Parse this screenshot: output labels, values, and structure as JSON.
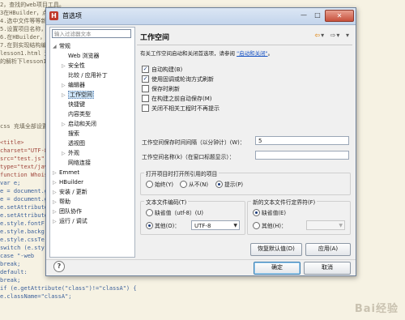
{
  "background_code": {
    "lines": [
      "2，查找的web项目工具。",
      "3在HBuilder，点击\"新建",
      "4.选中文件等等新建。",
      "5.设置项目名称，建立目录，",
      "6.在HBuilder，新建项目，复制",
      "7.在到实现结构编辑位置，的编辑文件",
      "lesson1.html 运行文件的",
      "的解析下lesson1基本结构",
      "",
      "",
      "",
      "",
      "",
      "",
      "",
      "css 充填全部设置",
      "",
      "<title>",
      "charset=\"UTF-8\"",
      "src=\"test.js\"",
      "type=\"text/java",
      "function Whoist (",
      "var e;",
      "e = document.get",
      "e = document.get",
      "e.setAttribute",
      "e.setAttribute",
      "e.style.fontF",
      "e.style.backg",
      "e.style.cssTe",
      "switch (e.sty",
      "    case \"-web",
      "        break;",
      "    default:",
      "        break;",
      "if (e.getAttribute(\"class\")!=\"classA\") {",
      "    e.className=\"classA\";"
    ],
    "watermark": "Bai经验"
  },
  "dialog": {
    "title": "首选项",
    "app_icon_letter": "H",
    "window_controls": {
      "minimize": "—",
      "maximize": "□",
      "close": "✕"
    }
  },
  "left_panel": {
    "filter_placeholder": "输入过滤器文本",
    "tree": [
      {
        "label": "常规",
        "arrow": "◢",
        "level": 0
      },
      {
        "label": "Web 浏览器",
        "arrow": "",
        "level": 1
      },
      {
        "label": "安全性",
        "arrow": "▷",
        "level": 1
      },
      {
        "label": "比较 / 应用补丁",
        "arrow": "",
        "level": 1
      },
      {
        "label": "编辑器",
        "arrow": "▷",
        "level": 1
      },
      {
        "label": "工作空间",
        "arrow": "▷",
        "level": 1,
        "selected": true
      },
      {
        "label": "快捷键",
        "arrow": "",
        "level": 1
      },
      {
        "label": "内容类型",
        "arrow": "",
        "level": 1
      },
      {
        "label": "启动和关闭",
        "arrow": "▷",
        "level": 1
      },
      {
        "label": "搜索",
        "arrow": "",
        "level": 1
      },
      {
        "label": "透视图",
        "arrow": "",
        "level": 1
      },
      {
        "label": "外观",
        "arrow": "▷",
        "level": 1
      },
      {
        "label": "网络连接",
        "arrow": "",
        "level": 1
      },
      {
        "label": "Emmet",
        "arrow": "▷",
        "level": 0
      },
      {
        "label": "HBuilder",
        "arrow": "▷",
        "level": 0
      },
      {
        "label": "安装 / 更新",
        "arrow": "▷",
        "level": 0
      },
      {
        "label": "帮助",
        "arrow": "▷",
        "level": 0
      },
      {
        "label": "团队协作",
        "arrow": "▷",
        "level": 0
      },
      {
        "label": "运行 / 调试",
        "arrow": "▷",
        "level": 0
      }
    ]
  },
  "right_panel": {
    "title": "工作空间",
    "nav": {
      "back": "⇦",
      "back_menu": "▾",
      "forward": "⇨",
      "forward_menu": "▾",
      "view_menu": "▾"
    },
    "description": "有关工作空间启动和关闭首选项，请参阅",
    "description_link": "\"启动和关闭\"",
    "description_end": "。",
    "checkboxes": [
      {
        "label": "自动构建(B)",
        "checked": true
      },
      {
        "label": "使用固调或轮询方式刷新",
        "checked": true
      },
      {
        "label": "保存时刷新",
        "checked": false
      },
      {
        "label": "在构建之前自动保存(M)",
        "checked": false
      },
      {
        "label": "关闭不相关工程时不再提示",
        "checked": false
      }
    ],
    "save_interval_label": "工作空间保存时间间隔（以分钟计）(W)：",
    "save_interval_value": "5",
    "workspace_name_label": "工作空间名称(k)（在窗口标题显示）：",
    "workspace_name_value": "",
    "open_projects_group": {
      "title": "打开项目时打开所引用的项目",
      "options": [
        {
          "label": "始终(Y)",
          "selected": false
        },
        {
          "label": "从不(N)",
          "selected": false
        },
        {
          "label": "提示(P)",
          "selected": true
        }
      ]
    },
    "encoding_group": {
      "title": "文本文件编码(T)",
      "default_label": "缺省值（utf-8）(U)",
      "other_label": "其他(O)：",
      "other_selected": true,
      "other_value": "UTF-8"
    },
    "line_delimiter_group": {
      "title": "新的文本文件行定界符(F)",
      "default_label": "缺省值(E)",
      "default_selected": true,
      "other_label": "其他(H)：",
      "other_value": ""
    },
    "restore_defaults_label": "恢复默认值(D)",
    "apply_label": "应用(A)"
  },
  "footer": {
    "help_symbol": "?",
    "ok_label": "确定",
    "cancel_label": "取消"
  }
}
